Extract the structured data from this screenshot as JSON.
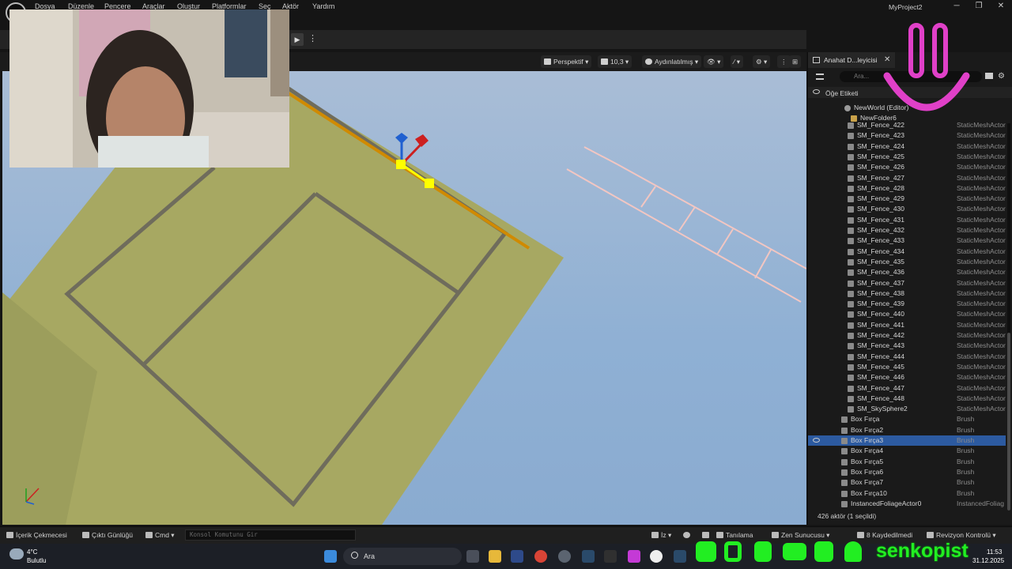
{
  "menubar": {
    "items": [
      "Dosya",
      "Düzenle",
      "Pencere",
      "Araçlar",
      "Oluştur",
      "Platformlar",
      "Seç",
      "Aktör",
      "Yardım"
    ],
    "project_title": "MyProject2",
    "window_buttons": [
      "─",
      "❐",
      "✕"
    ]
  },
  "toolbar": {
    "play_glyph": "▶",
    "more_glyph": "⋮"
  },
  "viewport": {
    "perspective_label": "Perspektif ▾",
    "fov_label": "10,3 ▾",
    "lighting_label": "Aydınlatılmış ▾",
    "show_glyph": "👁 ▾",
    "snap_glyph": "⁄ ▾",
    "settings_glyph": "⚙ ▾",
    "more_glyph": "⋮",
    "layout_glyph": "⊞"
  },
  "outliner": {
    "tab_label": "Anahat D...leyicisi",
    "close_glyph": "✕",
    "search_placeholder": "Ara...",
    "settings_glyph": "⚙",
    "column_label": "Öğe Etiketi",
    "tree": [
      {
        "label": "NewWorld (Editor)",
        "type": "",
        "indent": 46,
        "icon": "world"
      },
      {
        "label": "NewFolder6",
        "type": "",
        "indent": 54,
        "icon": "folder"
      }
    ],
    "fences": [
      {
        "label": "SM_Fence_422",
        "type": "StaticMeshActor"
      },
      {
        "label": "SM_Fence_423",
        "type": "StaticMeshActor"
      },
      {
        "label": "SM_Fence_424",
        "type": "StaticMeshActor"
      },
      {
        "label": "SM_Fence_425",
        "type": "StaticMeshActor"
      },
      {
        "label": "SM_Fence_426",
        "type": "StaticMeshActor"
      },
      {
        "label": "SM_Fence_427",
        "type": "StaticMeshActor"
      },
      {
        "label": "SM_Fence_428",
        "type": "StaticMeshActor"
      },
      {
        "label": "SM_Fence_429",
        "type": "StaticMeshActor"
      },
      {
        "label": "SM_Fence_430",
        "type": "StaticMeshActor"
      },
      {
        "label": "SM_Fence_431",
        "type": "StaticMeshActor"
      },
      {
        "label": "SM_Fence_432",
        "type": "StaticMeshActor"
      },
      {
        "label": "SM_Fence_433",
        "type": "StaticMeshActor"
      },
      {
        "label": "SM_Fence_434",
        "type": "StaticMeshActor"
      },
      {
        "label": "SM_Fence_435",
        "type": "StaticMeshActor"
      },
      {
        "label": "SM_Fence_436",
        "type": "StaticMeshActor"
      },
      {
        "label": "SM_Fence_437",
        "type": "StaticMeshActor"
      },
      {
        "label": "SM_Fence_438",
        "type": "StaticMeshActor"
      },
      {
        "label": "SM_Fence_439",
        "type": "StaticMeshActor"
      },
      {
        "label": "SM_Fence_440",
        "type": "StaticMeshActor"
      },
      {
        "label": "SM_Fence_441",
        "type": "StaticMeshActor"
      },
      {
        "label": "SM_Fence_442",
        "type": "StaticMeshActor"
      },
      {
        "label": "SM_Fence_443",
        "type": "StaticMeshActor"
      },
      {
        "label": "SM_Fence_444",
        "type": "StaticMeshActor"
      },
      {
        "label": "SM_Fence_445",
        "type": "StaticMeshActor"
      },
      {
        "label": "SM_Fence_446",
        "type": "StaticMeshActor"
      },
      {
        "label": "SM_Fence_447",
        "type": "StaticMeshActor"
      },
      {
        "label": "SM_Fence_448",
        "type": "StaticMeshActor"
      },
      {
        "label": "SM_SkySphere2",
        "type": "StaticMeshActor"
      }
    ],
    "brushes": [
      {
        "label": "Box Fırça",
        "type": "Brush",
        "selected": false
      },
      {
        "label": "Box Fırça2",
        "type": "Brush",
        "selected": false
      },
      {
        "label": "Box Fırça3",
        "type": "Brush",
        "selected": true
      },
      {
        "label": "Box Fırça4",
        "type": "Brush",
        "selected": false
      },
      {
        "label": "Box Fırça5",
        "type": "Brush",
        "selected": false
      },
      {
        "label": "Box Fırça6",
        "type": "Brush",
        "selected": false
      },
      {
        "label": "Box Fırça7",
        "type": "Brush",
        "selected": false
      },
      {
        "label": "Box Fırça10",
        "type": "Brush",
        "selected": false
      },
      {
        "label": "InstancedFoliageActor0",
        "type": "InstancedFoliag",
        "selected": false
      }
    ],
    "footer": "426 aktör (1 seçildi)"
  },
  "statusbar": {
    "content_drawer": "İçerik Çekmecesi",
    "output_log": "Çıktı Günlüğü",
    "cmd": "Cmd ▾",
    "console_placeholder": "Konsol Komutunu Gir",
    "trace": "İz ▾",
    "derived": "Tanılama",
    "zen": "Zen Sunucusu ▾",
    "unsaved": "8 Kaydedilmedi",
    "revision": "Revizyon Kontrolü ▾"
  },
  "taskbar": {
    "temperature": "4°C",
    "weather": "Bulutlu",
    "search_label": "Ara",
    "time": "11:53",
    "date": "31.12.2025",
    "handle": "senkopist"
  },
  "colors": {
    "selection": "#2c5aa0",
    "ground": "#a7a862",
    "sky": "#8fb0d4",
    "overlay_pink": "#e040c8",
    "overlay_green": "#22ee22"
  }
}
